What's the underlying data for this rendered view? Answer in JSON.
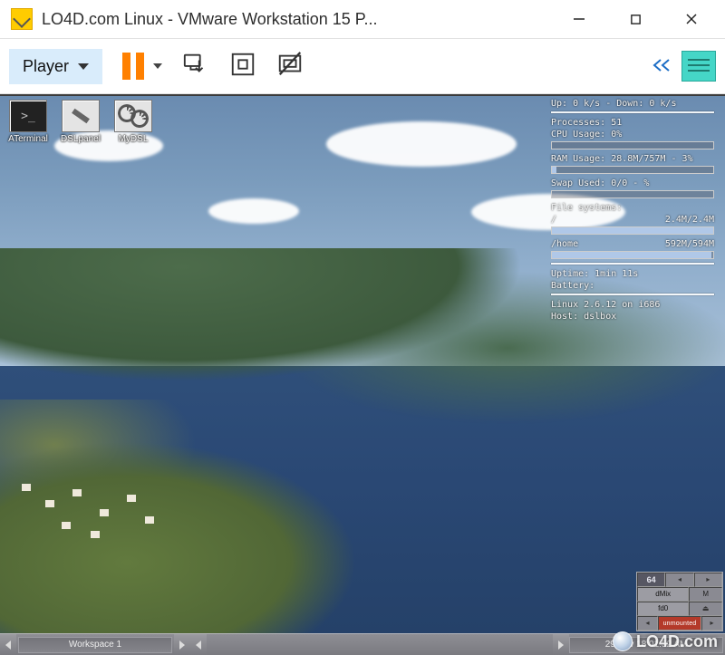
{
  "window": {
    "title": "LO4D.com Linux - VMware Workstation 15 P..."
  },
  "toolbar": {
    "player_label": "Player"
  },
  "desktop_icons": [
    {
      "id": "terminal",
      "label": "ATerminal",
      "glyph": ">_"
    },
    {
      "id": "dslpanel",
      "label": "DSLpanel",
      "glyph": ""
    },
    {
      "id": "mydsl",
      "label": "MyDSL",
      "glyph": ""
    }
  ],
  "sysmon": {
    "netline": "Up: 0 k/s - Down: 0 k/s",
    "processes": "Processes: 51",
    "cpu": "CPU Usage: 0%",
    "cpu_pct": 0,
    "ram": "RAM Usage: 28.8M/757M - 3%",
    "ram_pct": 3,
    "swap": "Swap Used: 0/0 - %",
    "swap_pct": 0,
    "fs_title": "File systems:",
    "fs_root": {
      "label": "/",
      "value": "2.4M/2.4M",
      "pct": 100
    },
    "fs_home": {
      "label": "/home",
      "value": "592M/594M",
      "pct": 99
    },
    "uptime": "Uptime:   1min 11s",
    "battery": "Battery:",
    "kernel": "Linux 2.6.12 on i686",
    "host": "Host: dslbox"
  },
  "fluxbar": {
    "workspace": "Workspace 1",
    "clock": "29 Nov 18 01:52 AM"
  },
  "dock": {
    "num": "64",
    "dmix": "dMix",
    "m": "M",
    "fd0": "fd0",
    "unmounted": "unmounted"
  },
  "watermark": "LO4D.com"
}
